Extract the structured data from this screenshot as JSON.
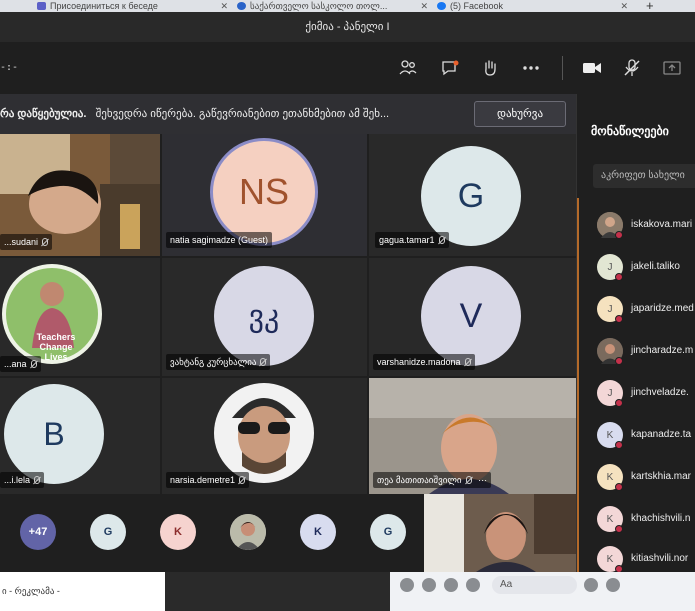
{
  "browser": {
    "tabs": [
      {
        "label": "Присоединиться к беседе",
        "color": "#5b5fc7"
      },
      {
        "label": "საქართველო სასკოლო თოლ...",
        "color": "#2a63c8"
      },
      {
        "label": "(5) Facebook",
        "color": "#1877f2"
      }
    ],
    "new_tab": "+"
  },
  "window": {
    "title": "ქიმია - პანელი I"
  },
  "toolbar": {
    "timer": "-:-"
  },
  "banner": {
    "bold_text": "რა დაწყებულია.",
    "text": "შეხვედრა იწერება. გაწევრიანებით ეთანხმებით ამ შეხ...",
    "close_label": "დახურვა"
  },
  "tiles": [
    {
      "name": "...sudani",
      "type": "video"
    },
    {
      "name": "natia sagimadze (Guest)",
      "initials": "NS",
      "type": "avatar"
    },
    {
      "name": "gagua.tamar1",
      "initials": "G",
      "type": "avatar"
    },
    {
      "name": "...ana",
      "type": "photo",
      "overlay": "Teachers Change Lives"
    },
    {
      "name": "ვახტანგ კურცხალია",
      "initials": "ვკ",
      "type": "avatar"
    },
    {
      "name": "varshanidze.madona",
      "initials": "V",
      "type": "avatar"
    },
    {
      "name": "...i.lela",
      "initials": "B",
      "type": "avatar"
    },
    {
      "name": "narsia.demetre1",
      "type": "photo"
    },
    {
      "name": "თეა მათითაიშვილი",
      "type": "video"
    }
  ],
  "participants_bar": {
    "more_count": "+47",
    "chips": [
      "G",
      "K",
      "",
      "K",
      "G"
    ]
  },
  "panel": {
    "title": "მონაწილეები",
    "search_placeholder": "აკრიფეთ სახელი",
    "people": [
      {
        "name": "iskakova.mari",
        "initial": ""
      },
      {
        "name": "jakeli.taliko",
        "initial": "J"
      },
      {
        "name": "japaridze.med",
        "initial": "J"
      },
      {
        "name": "jincharadze.m",
        "initial": ""
      },
      {
        "name": "jinchveladze.",
        "initial": "J"
      },
      {
        "name": "kapanadze.ta",
        "initial": "K"
      },
      {
        "name": "kartskhia.mar",
        "initial": "K"
      },
      {
        "name": "khachishvili.n",
        "initial": "K"
      },
      {
        "name": "kitiashvili.nor",
        "initial": "K"
      }
    ]
  },
  "bottom": {
    "left_text": "ი - რეკლამა -",
    "fb_input": "Aa"
  },
  "colors": {
    "accent": "#6264a7",
    "avatar_light": "#dde8ea",
    "avatar_ns": "#f5d0c1",
    "avatar_grey": "#d8d8e6"
  }
}
